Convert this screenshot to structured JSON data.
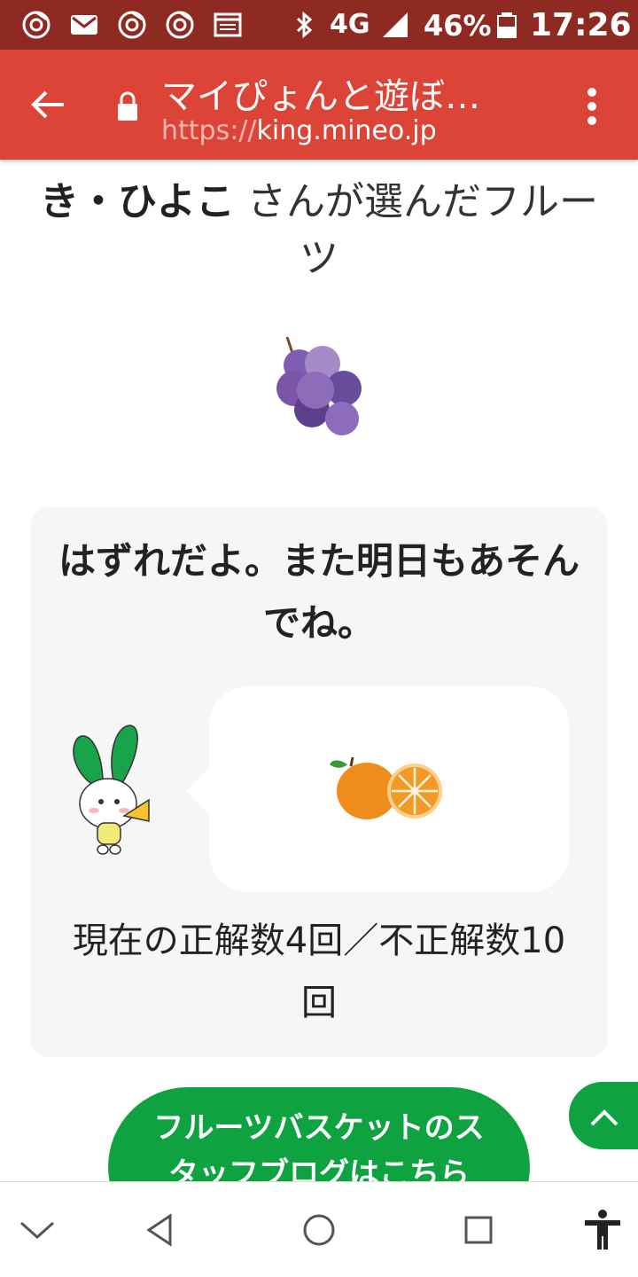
{
  "status_bar": {
    "network": "4G",
    "battery_percent": "46%",
    "time": "17:26",
    "icons": [
      "chrome-icon",
      "gmail-icon",
      "chrome-icon",
      "chrome-icon",
      "news-icon",
      "bluetooth-icon",
      "signal-icon",
      "battery-icon"
    ]
  },
  "browser": {
    "title": "マイぴょんと遊ぼ…",
    "url_scheme": "https://",
    "url_host": "king.mineo.jp"
  },
  "page": {
    "user_name": "き・ひよこ",
    "heading_suffix": " さんが選んだフルーツ",
    "user_fruit": "grape",
    "result_message": "はずれだよ。また明日もあそんでね。",
    "mascot_fruit": "orange",
    "score_text": "現在の正解数4回／不正解数10回",
    "blog_button_label": "フルーツバスケットのスタッフブログはこちら"
  },
  "colors": {
    "status_bar": "#8e2a22",
    "app_bar": "#db4437",
    "card_bg": "#f5f6f5",
    "button_green": "#0fa240",
    "grape": "#7a55a8",
    "orange": "#ef8c1c"
  },
  "nav": {
    "icons": [
      "chevron-down-icon",
      "back-triangle-icon",
      "home-circle-icon",
      "recents-square-icon",
      "accessibility-icon"
    ]
  }
}
